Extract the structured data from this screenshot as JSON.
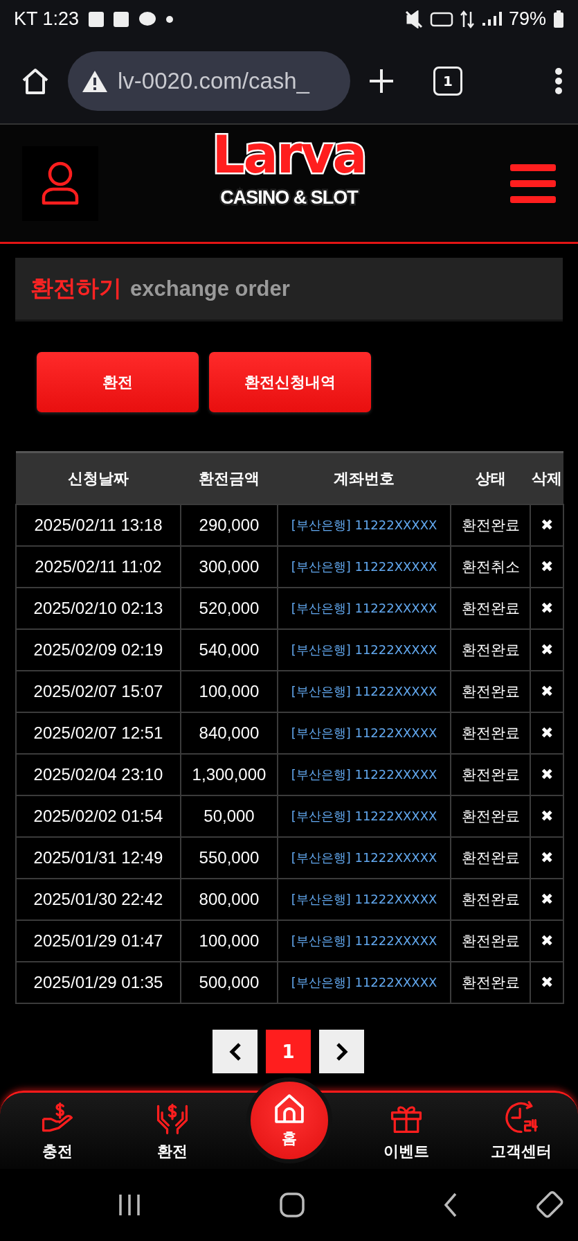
{
  "status_bar": {
    "carrier_time": "KT 1:23",
    "battery": "79%"
  },
  "browser": {
    "url": "lv-0020.com/cash_",
    "tab_count": "1"
  },
  "logo": {
    "name": "Larva",
    "tagline": "CASINO & SLOT"
  },
  "page_title": {
    "korean": "환전하기",
    "english": "exchange order"
  },
  "buttons": [
    "환전",
    "환전신청내역"
  ],
  "table": {
    "columns": [
      "신청날짜",
      "환전금액",
      "계좌번호",
      "상태",
      "삭제"
    ],
    "rows": [
      {
        "date": "2025/02/11 13:18",
        "amount": "290,000",
        "account": "[부산은행] 11222XXXXX",
        "status": "환전완료",
        "delete": "✖"
      },
      {
        "date": "2025/02/11 11:02",
        "amount": "300,000",
        "account": "[부산은행] 11222XXXXX",
        "status": "환전취소",
        "delete": "✖"
      },
      {
        "date": "2025/02/10 02:13",
        "amount": "520,000",
        "account": "[부산은행] 11222XXXXX",
        "status": "환전완료",
        "delete": "✖"
      },
      {
        "date": "2025/02/09 02:19",
        "amount": "540,000",
        "account": "[부산은행] 11222XXXXX",
        "status": "환전완료",
        "delete": "✖"
      },
      {
        "date": "2025/02/07 15:07",
        "amount": "100,000",
        "account": "[부산은행] 11222XXXXX",
        "status": "환전완료",
        "delete": "✖"
      },
      {
        "date": "2025/02/07 12:51",
        "amount": "840,000",
        "account": "[부산은행] 11222XXXXX",
        "status": "환전완료",
        "delete": "✖"
      },
      {
        "date": "2025/02/04 23:10",
        "amount": "1,300,000",
        "account": "[부산은행] 11222XXXXX",
        "status": "환전완료",
        "delete": "✖"
      },
      {
        "date": "2025/02/02 01:54",
        "amount": "50,000",
        "account": "[부산은행] 11222XXXXX",
        "status": "환전완료",
        "delete": "✖"
      },
      {
        "date": "2025/01/31 12:49",
        "amount": "550,000",
        "account": "[부산은행] 11222XXXXX",
        "status": "환전완료",
        "delete": "✖"
      },
      {
        "date": "2025/01/30 22:42",
        "amount": "800,000",
        "account": "[부산은행] 11222XXXXX",
        "status": "환전완료",
        "delete": "✖"
      },
      {
        "date": "2025/01/29 01:47",
        "amount": "100,000",
        "account": "[부산은행] 11222XXXXX",
        "status": "환전완료",
        "delete": "✖"
      },
      {
        "date": "2025/01/29 01:35",
        "amount": "500,000",
        "account": "[부산은행] 11222XXXXX",
        "status": "환전완료",
        "delete": "✖"
      }
    ]
  },
  "pagination": {
    "pages": [
      {
        "label": "1",
        "selected": true
      }
    ]
  },
  "bottom_nav": [
    {
      "label": "충전",
      "kind": "charge"
    },
    {
      "label": "환전",
      "kind": "exchange"
    },
    {
      "label": "홈",
      "kind": "home"
    },
    {
      "label": "이벤트",
      "kind": "event"
    },
    {
      "label": "고객센터",
      "kind": "support"
    }
  ]
}
